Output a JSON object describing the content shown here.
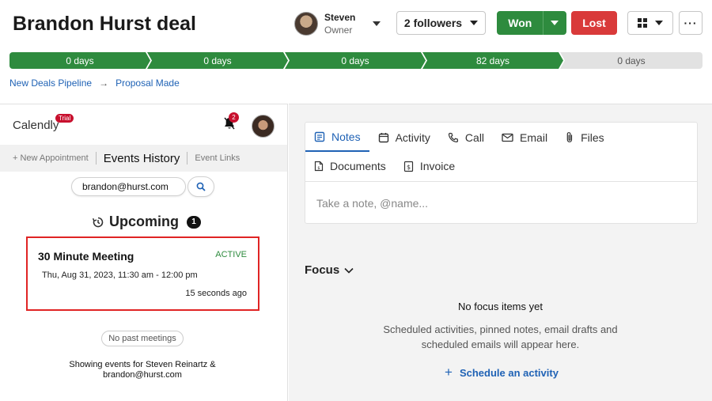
{
  "deal": {
    "title": "Brandon Hurst deal",
    "owner_name": "Steven",
    "owner_role": "Owner",
    "followers_label": "2 followers",
    "won_label": "Won",
    "lost_label": "Lost",
    "more_label": "···"
  },
  "pipeline": {
    "stages": [
      {
        "label": "0 days",
        "complete": true
      },
      {
        "label": "0 days",
        "complete": true
      },
      {
        "label": "0 days",
        "complete": true
      },
      {
        "label": "82 days",
        "complete": true
      },
      {
        "label": "0 days",
        "complete": false
      }
    ],
    "breadcrumb": [
      "New Deals Pipeline",
      "Proposal Made"
    ],
    "breadcrumb_sep": "→"
  },
  "calendly": {
    "logo": "Calendly",
    "trial_badge": "Trial",
    "notification_count": "2",
    "tabs": [
      "+ New Appointment",
      "Events History",
      "Event Links"
    ],
    "search_value": "brandon@hurst.com",
    "upcoming_label": "Upcoming",
    "upcoming_count": "1",
    "meeting": {
      "title": "30 Minute Meeting",
      "status": "ACTIVE",
      "datetime": "Thu, Aug 31, 2023, 11:30 am - 12:00 pm",
      "ago": "15 seconds ago"
    },
    "past_label": "No past meetings",
    "showing_text": "Showing events for Steven Reinartz & brandon@hurst.com"
  },
  "composer": {
    "tabs_row1": [
      {
        "label": "Notes",
        "icon": "notes-icon"
      },
      {
        "label": "Activity",
        "icon": "calendar-icon"
      },
      {
        "label": "Call",
        "icon": "phone-icon"
      },
      {
        "label": "Email",
        "icon": "mail-icon"
      },
      {
        "label": "Files",
        "icon": "paperclip-icon"
      }
    ],
    "tabs_row2": [
      {
        "label": "Documents",
        "icon": "document-icon"
      },
      {
        "label": "Invoice",
        "icon": "invoice-icon"
      }
    ],
    "placeholder": "Take a note, @name..."
  },
  "focus": {
    "title": "Focus",
    "empty_title": "No focus items yet",
    "empty_sub": "Scheduled activities, pinned notes, email drafts and scheduled emails will appear here.",
    "schedule_label": "Schedule an activity"
  },
  "colors": {
    "won": "#2e8b3e",
    "lost": "#d93a3a",
    "link": "#1f62b5",
    "highlight": "#e02424"
  }
}
